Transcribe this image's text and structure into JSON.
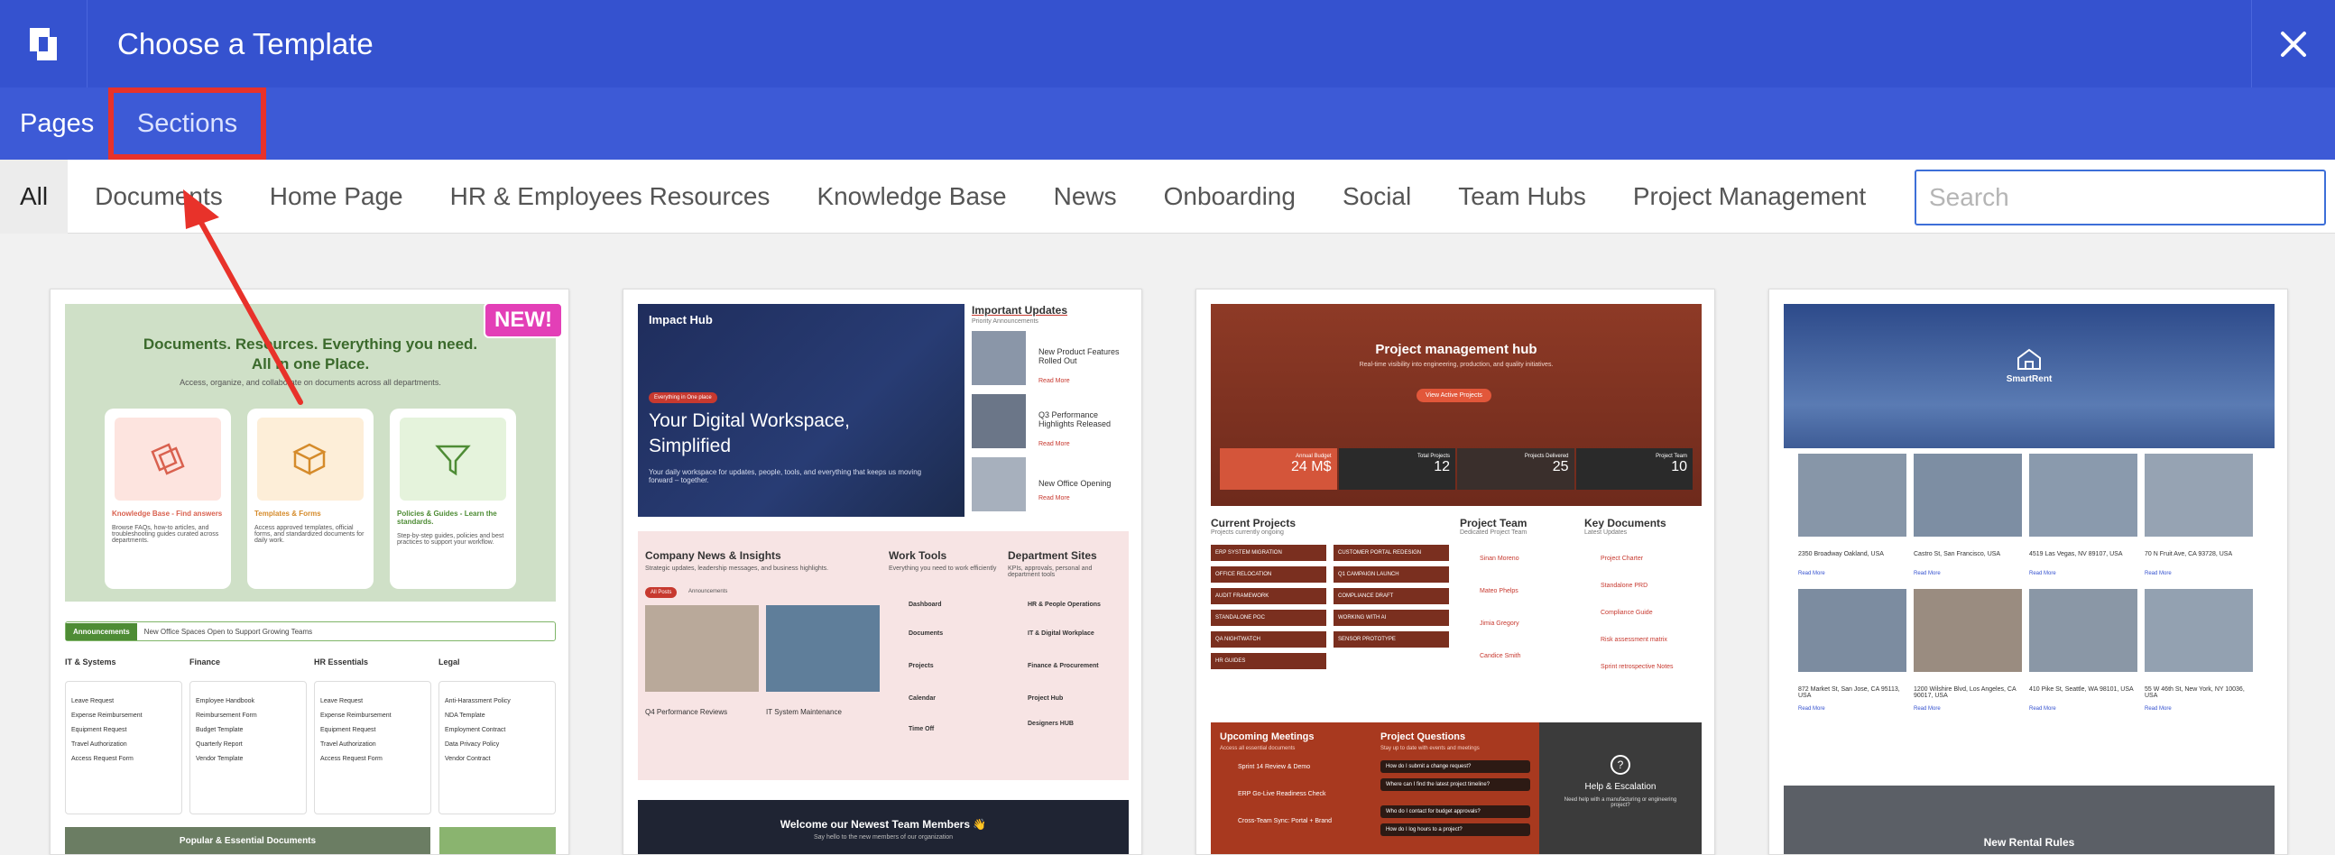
{
  "header": {
    "title": "Choose a Template",
    "close_icon": "close-icon",
    "logo_icon": "app-logo-icon"
  },
  "mode_tabs": [
    {
      "label": "Pages"
    },
    {
      "label": "Sections",
      "highlighted": true
    }
  ],
  "filters": [
    {
      "label": "All",
      "active": true
    },
    {
      "label": "Documents"
    },
    {
      "label": "Home Page"
    },
    {
      "label": "HR & Employees Resources"
    },
    {
      "label": "Knowledge Base"
    },
    {
      "label": "News"
    },
    {
      "label": "Onboarding"
    },
    {
      "label": "Social"
    },
    {
      "label": "Team Hubs"
    },
    {
      "label": "Project Management"
    }
  ],
  "search": {
    "placeholder": "Search",
    "value": ""
  },
  "colors": {
    "header": "#3552cf",
    "subheader": "#3d5ad6",
    "annotation": "#e8322a",
    "new_badge": "#e33fb7"
  },
  "templates": [
    {
      "badge": "NEW!",
      "hero": "Documents. Resources. Everything you need. All in one Place.",
      "hero_sub": "Access, organize, and collaborate on documents across all departments.",
      "tiles": [
        {
          "title": "Knowledge Base - Find answers",
          "text": "Browse FAQs, how-to articles, and troubleshooting guides curated across departments."
        },
        {
          "title": "Templates & Forms",
          "text": "Access approved templates, official forms, and standardized documents for daily work."
        },
        {
          "title": "Policies & Guides - Learn the standards.",
          "text": "Step-by-step guides, policies and best practices to support your workflow."
        }
      ],
      "announcement_tag": "Announcements",
      "announcement": "New Office Spaces Open to Support Growing Teams",
      "categories": [
        "IT & Systems",
        "Finance",
        "HR Essentials",
        "Legal"
      ],
      "col_items": [
        [
          "Leave Request",
          "Expense Reimbursement",
          "Equipment Request",
          "Travel Authorization",
          "Access Request Form"
        ],
        [
          "Employee Handbook",
          "Reimbursement Form",
          "Budget Template",
          "Quarterly Report",
          "Vendor Template"
        ],
        [
          "Leave Request",
          "Expense Reimbursement",
          "Equipment Request",
          "Travel Authorization",
          "Access Request Form"
        ],
        [
          "Anti-Harassment Policy",
          "NDA Template",
          "Employment Contract",
          "Data Privacy Policy",
          "Vendor Contract"
        ]
      ],
      "footer": "Popular & Essential Documents"
    },
    {
      "brand": "Impact Hub",
      "hero_tag": "Everything in One place",
      "hero_title": "Your Digital Workspace, Simplified",
      "hero_sub": "Your daily workspace for updates, people, tools, and everything that keeps us moving forward – together.",
      "updates_title": "Important Updates",
      "updates_sub": "Priority Announcements",
      "updates": [
        "New Product Features Rolled Out",
        "Q3 Performance Highlights Released",
        "New Office Opening"
      ],
      "read_more": "Read More",
      "news_title": "Company News & Insights",
      "news_sub": "Strategic updates, leadership messages, and business highlights.",
      "news_tabs": [
        "All Posts",
        "Announcements"
      ],
      "news_items": [
        "Q4 Performance Reviews",
        "IT System Maintenance"
      ],
      "tools_title": "Work Tools",
      "tools_sub": "Everything you need to work efficiently",
      "tools": [
        "Dashboard",
        "Documents",
        "Projects",
        "Calendar",
        "Time Off"
      ],
      "dept_title": "Department Sites",
      "dept_sub": "KPIs, approvals, personal and department tools",
      "depts": [
        "HR & People Operations",
        "IT & Digital Workplace",
        "Finance & Procurement",
        "Project Hub",
        "Designers HUB"
      ],
      "welcome": "Welcome our Newest Team Members 👋",
      "welcome_sub": "Say hello to the new members of our organization"
    },
    {
      "hero_title": "Project management hub",
      "hero_sub": "Real-time visibility into engineering, production, and quality initiatives.",
      "hero_button": "View Active Projects",
      "stats": [
        {
          "label": "Annual Budget",
          "value": "24 M$"
        },
        {
          "label": "Total Projects",
          "value": "12"
        },
        {
          "label": "Projects Delivered",
          "value": "25"
        },
        {
          "label": "Project Team",
          "value": "10"
        }
      ],
      "current_title": "Current Projects",
      "current_sub": "Projects currently ongoing",
      "projects": [
        "ERP SYSTEM MIGRATION",
        "CUSTOMER PORTAL REDESIGN",
        "OFFICE RELOCATION",
        "Q1 CAMPAIGN LAUNCH",
        "AUDIT FRAMEWORK",
        "COMPLIANCE DRAFT",
        "STANDALONE POC",
        "WORKING WITH AI",
        "QA NIGHTWATCH",
        "SENSOR PROTOTYPE",
        "HR GUIDES"
      ],
      "team_title": "Project Team",
      "team_sub": "Dedicated Project Team",
      "team": [
        "Sinan Moreno",
        "Mateo Phelps",
        "Jimia Gregory",
        "Candice Smith"
      ],
      "docs_title": "Key Documents",
      "docs_sub": "Latest Updates",
      "docs": [
        "Project Charter",
        "Standalone PRD",
        "Compliance Guide",
        "Risk assessment matrix",
        "Sprint retrospective Notes"
      ],
      "meetings_title": "Upcoming Meetings",
      "meetings_sub": "Access all essential documents",
      "meetings": [
        "Sprint 14 Review & Demo",
        "ERP Go-Live Readiness Check",
        "Cross-Team Sync: Portal + Brand"
      ],
      "questions_title": "Project Questions",
      "questions_sub": "Stay up to date with events and meetings",
      "questions": [
        "How do I submit a change request?",
        "Where can I find the latest project timeline?",
        "Who do I contact for budget approvals?",
        "How do I log hours to a project?"
      ],
      "help_title": "Help & Escalation",
      "help_text": "Need help with a manufacturing or engineering project?"
    },
    {
      "brand": "SmartRent",
      "listings": [
        "2350 Broadway Oakland, USA",
        "Castro St, San Francisco, USA",
        "4519 Las Vegas, NV 89107, USA",
        "70 N Fruit Ave, CA 93728, USA",
        "872 Market St, San Jose, CA 95113, USA",
        "1200 Wilshire Blvd, Los Angeles, CA 90017, USA",
        "410 Pike St, Seattle, WA 98101, USA",
        "55 W 46th St, New York, NY 10036, USA"
      ],
      "read_more": "Read More",
      "rules_title": "New Rental Rules"
    }
  ]
}
